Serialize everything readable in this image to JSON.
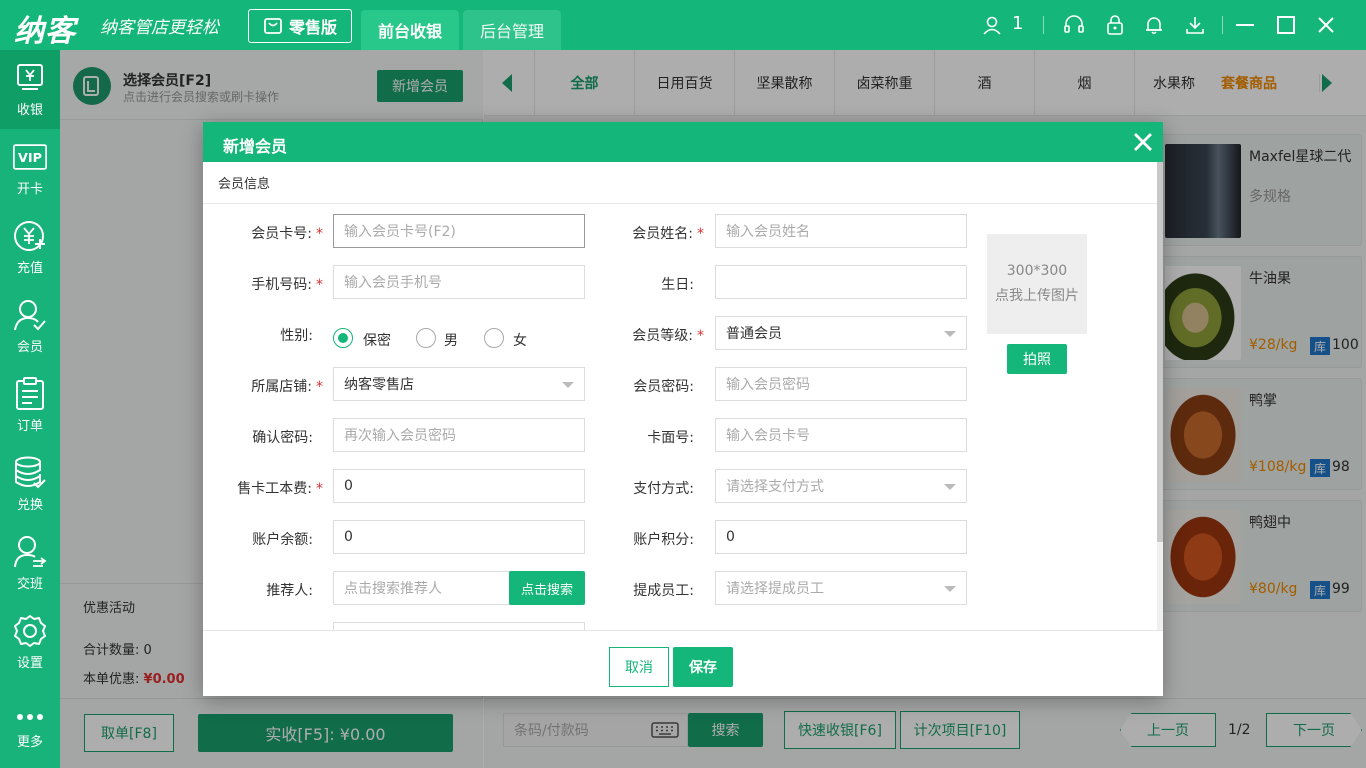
{
  "app": {
    "logo": "纳客",
    "slogan": "纳客管店更轻松"
  },
  "topbar": {
    "retail_label": "零售版",
    "nav": [
      "前台收银",
      "后台管理"
    ],
    "user_count": "1"
  },
  "leftnav": [
    "收银",
    "开卡",
    "充值",
    "会员",
    "订单",
    "兑换",
    "交班",
    "设置",
    "更多"
  ],
  "member": {
    "title": "选择会员[F2]",
    "subtitle": "点击进行会员搜索或刷卡操作",
    "add_btn": "新增会员"
  },
  "summary": {
    "promo": "优惠活动",
    "count_label": "合计数量:",
    "count_value": "0",
    "discount_label": "本单优惠:",
    "discount_value": "¥0.00"
  },
  "left_bottom": {
    "cancel": "取单[F8]",
    "pay": "实收[F5]: ¥0.00"
  },
  "categories": [
    "全部",
    "日用百货",
    "坚果散称",
    "卤菜称重",
    "酒",
    "烟",
    "水果称",
    "套餐商品"
  ],
  "products": [
    {
      "name": "Maxfel星球二代",
      "sub": "多规格",
      "price": "",
      "stock": ""
    },
    {
      "name": "牛油果",
      "sub": "",
      "price": "¥28/kg",
      "stock": "100"
    },
    {
      "name": "鸭掌",
      "sub": "",
      "price": "¥108/kg",
      "stock": "98"
    },
    {
      "name": "鸭翅中",
      "sub": "",
      "price": "¥80/kg",
      "stock": "99"
    }
  ],
  "stock_badge": "库",
  "right_bottom": {
    "barcode_placeholder": "条码/付款码",
    "search": "搜索",
    "quick": "快速收银[F6]",
    "count_item": "计次项目[F10]",
    "prev": "上一页",
    "page": "1/2",
    "next": "下一页"
  },
  "modal": {
    "title": "新增会员",
    "section": "会员信息",
    "fields": {
      "card_no": {
        "label": "会员卡号:",
        "placeholder": "输入会员卡号(F2)"
      },
      "name": {
        "label": "会员姓名:",
        "placeholder": "输入会员姓名"
      },
      "phone": {
        "label": "手机号码:",
        "placeholder": "输入会员手机号"
      },
      "birthday": {
        "label": "生日:",
        "value": ""
      },
      "gender": {
        "label": "性别:",
        "options": [
          "保密",
          "男",
          "女"
        ],
        "selected": "保密"
      },
      "level": {
        "label": "会员等级:",
        "value": "普通会员"
      },
      "store": {
        "label": "所属店铺:",
        "value": "纳客零售店"
      },
      "password": {
        "label": "会员密码:",
        "placeholder": "输入会员密码"
      },
      "confirm": {
        "label": "确认密码:",
        "placeholder": "再次输入会员密码"
      },
      "card_face": {
        "label": "卡面号:",
        "placeholder": "输入会员卡号"
      },
      "fee": {
        "label": "售卡工本费:",
        "value": "0"
      },
      "pay_method": {
        "label": "支付方式:",
        "placeholder": "请选择支付方式"
      },
      "balance": {
        "label": "账户余额:",
        "value": "0"
      },
      "points": {
        "label": "账户积分:",
        "value": "0"
      },
      "referrer": {
        "label": "推荐人:",
        "placeholder": "点击搜索推荐人",
        "button": "点击搜索"
      },
      "staff": {
        "label": "提成员工:",
        "placeholder": "请选择提成员工"
      }
    },
    "upload": {
      "size": "300*300",
      "text": "点我上传图片",
      "photo_btn": "拍照"
    },
    "cancel": "取消",
    "save": "保存"
  },
  "colors": {
    "brand": "#14b679",
    "dark_green": "#1a9f6d",
    "required": "#e03030",
    "price": "#f08a00",
    "badge": "#1f77c9"
  }
}
